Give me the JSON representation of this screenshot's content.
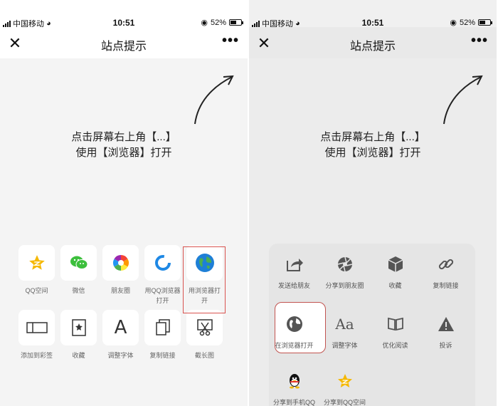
{
  "status": {
    "carrier": "中国移动",
    "time": "10:51",
    "battery": "52%"
  },
  "title": "站点提示",
  "hint": {
    "line1": "点击屏幕右上角【...】",
    "line2": "使用【浏览器】打开"
  },
  "left_share": {
    "row1": [
      "QQ空间",
      "微信",
      "朋友圈",
      "用QQ浏览器打开",
      "用浏览器打开"
    ],
    "row2": [
      "添加到彩签",
      "收藏",
      "调整字体",
      "复制链接",
      "截长图"
    ]
  },
  "right_sheet": {
    "row1": [
      "发送给朋友",
      "分享到朋友圈",
      "收藏",
      "复制链接"
    ],
    "row2": [
      "在浏览器打开",
      "调整字体",
      "优化阅读",
      "投诉"
    ],
    "row3": [
      "分享到手机QQ",
      "分享到QQ空间"
    ]
  },
  "colors": {
    "highlight": "#d9534f",
    "wechat_green": "#3cbf3c",
    "qzone_yellow": "#f5b800"
  }
}
